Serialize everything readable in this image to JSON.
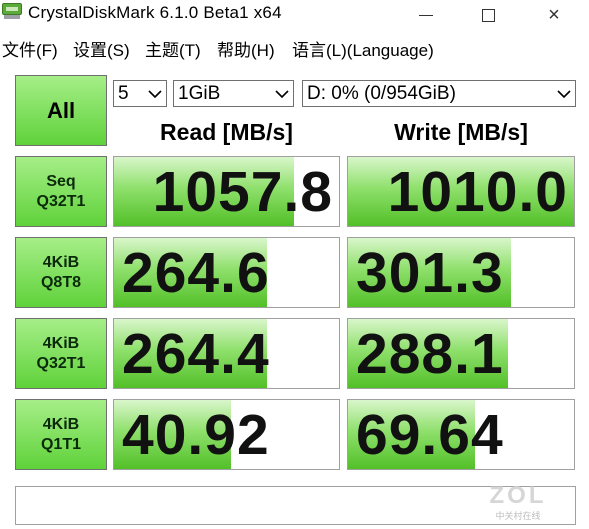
{
  "window": {
    "title": "CrystalDiskMark 6.1.0 Beta1 x64",
    "icon": "disk-icon",
    "controls": {
      "minimize": "minimize-icon",
      "maximize": "maximize-icon",
      "close": "×"
    }
  },
  "menu": [
    {
      "label": "文件(F)"
    },
    {
      "label": "设置(S)"
    },
    {
      "label": "主题(T)"
    },
    {
      "label": "帮助(H)"
    },
    {
      "label": "语言(L)(Language)"
    }
  ],
  "controls": {
    "all_button": "All",
    "test_count": "5",
    "test_size": "1GiB",
    "drive": "D: 0% (0/954GiB)"
  },
  "headers": {
    "read": "Read [MB/s]",
    "write": "Write [MB/s]"
  },
  "tests": [
    {
      "line1": "Seq",
      "line2": "Q32T1",
      "read": "1057.8",
      "write": "1010.0",
      "read_fill": 0.8,
      "write_fill": 1.0
    },
    {
      "line1": "4KiB",
      "line2": "Q8T8",
      "read": "264.6",
      "write": "301.3",
      "read_fill": 0.68,
      "write_fill": 0.72
    },
    {
      "line1": "4KiB",
      "line2": "Q32T1",
      "read": "264.4",
      "write": "288.1",
      "read_fill": 0.68,
      "write_fill": 0.71
    },
    {
      "line1": "4KiB",
      "line2": "Q1T1",
      "read": "40.92",
      "write": "69.64",
      "read_fill": 0.52,
      "write_fill": 0.56
    }
  ],
  "comment": "",
  "watermark": {
    "main": "ZOL",
    "sub": "中关村在线"
  },
  "colors": {
    "accent_green": "#5fd23a",
    "bar_green": "#52c028"
  }
}
